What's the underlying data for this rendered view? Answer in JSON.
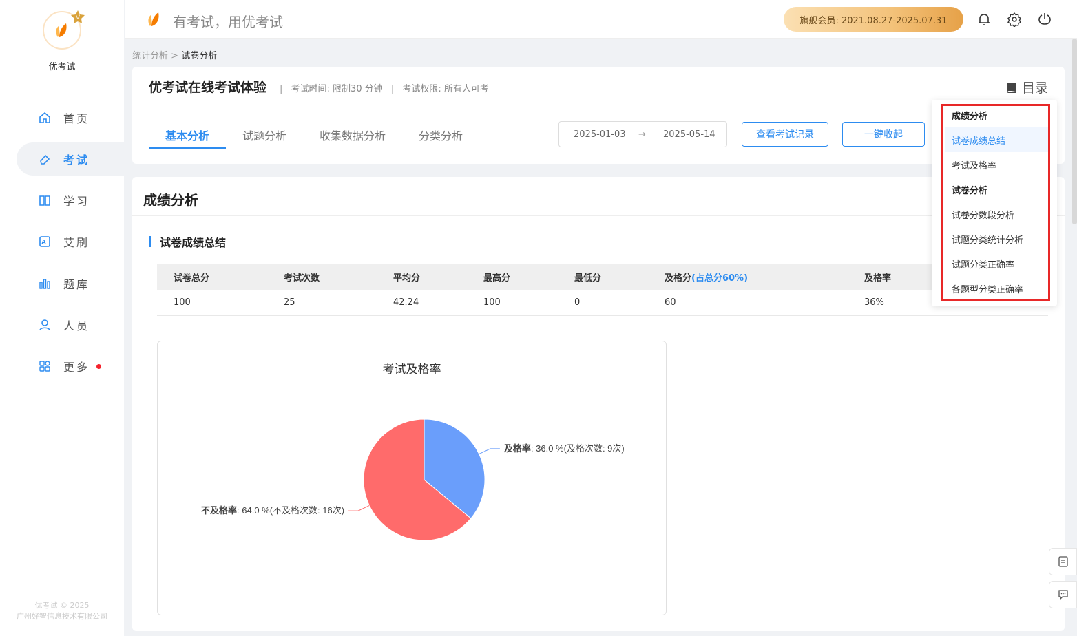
{
  "app": {
    "logo_text": "优考试",
    "slogan": "有考试，用优考试",
    "copyright_line1": "优考试 © 2025",
    "copyright_line2": "广州好智信息技术有限公司"
  },
  "sidebar": {
    "items": [
      {
        "label": "首页",
        "icon": "home-icon"
      },
      {
        "label": "考试",
        "icon": "eraser-icon",
        "active": true
      },
      {
        "label": "学习",
        "icon": "book-icon"
      },
      {
        "label": "艾刷",
        "icon": "a-square-icon"
      },
      {
        "label": "题库",
        "icon": "bars-icon"
      },
      {
        "label": "人员",
        "icon": "user-icon"
      },
      {
        "label": "更多",
        "icon": "grid-icon",
        "has_dot": true
      }
    ]
  },
  "topbar": {
    "member": "旗舰会员: 2021.08.27-2025.07.31",
    "icons": [
      "bell-icon",
      "gear-icon",
      "power-icon"
    ]
  },
  "breadcrumb": {
    "parent": "统计分析",
    "separator": ">",
    "current": "试卷分析"
  },
  "exam": {
    "title": "优考试在线考试体验",
    "time_label": "考试时间: 限制30 分钟",
    "permission_label": "考试权限: 所有人可考",
    "sep": "|"
  },
  "toc": {
    "label": "目录",
    "items": [
      {
        "label": "成绩分析",
        "group": true
      },
      {
        "label": "试卷成绩总结",
        "selected": true
      },
      {
        "label": "考试及格率"
      },
      {
        "label": "试卷分析",
        "group": true
      },
      {
        "label": "试卷分数段分析"
      },
      {
        "label": "试题分类统计分析"
      },
      {
        "label": "试题分类正确率"
      },
      {
        "label": "各题型分类正确率"
      }
    ]
  },
  "tabs": [
    {
      "label": "基本分析",
      "active": true
    },
    {
      "label": "试题分析"
    },
    {
      "label": "收集数据分析"
    },
    {
      "label": "分类分析"
    }
  ],
  "date_range": {
    "start": "2025-01-03",
    "arrow": "→",
    "end": "2025-05-14"
  },
  "buttons": {
    "view_records": "查看考试记录",
    "collapse_all": "一键收起"
  },
  "section": {
    "title": "成绩分析",
    "subtitle": "试卷成绩总结"
  },
  "summary_table": {
    "headers": [
      "试卷总分",
      "考试次数",
      "平均分",
      "最高分",
      "最低分",
      "及格分",
      "及格率"
    ],
    "pass_note": "(占总分60%)",
    "row": [
      "100",
      "25",
      "42.24",
      "100",
      "0",
      "60",
      "36%"
    ]
  },
  "chart_data": {
    "type": "pie",
    "title": "考试及格率",
    "slices": [
      {
        "name": "及格率",
        "value": 36.0,
        "count": 9,
        "label_rest": ": 36.0 %(及格次数: 9次)",
        "color": "#6a9efb"
      },
      {
        "name": "不及格率",
        "value": 64.0,
        "count": 16,
        "label_rest": ": 64.0 %(不及格次数: 16次)",
        "color": "#ff6b6b"
      }
    ]
  },
  "colors": {
    "accent": "#2d8cf0",
    "highlight_border": "#e82828",
    "member_gold": "#f3c27a"
  }
}
